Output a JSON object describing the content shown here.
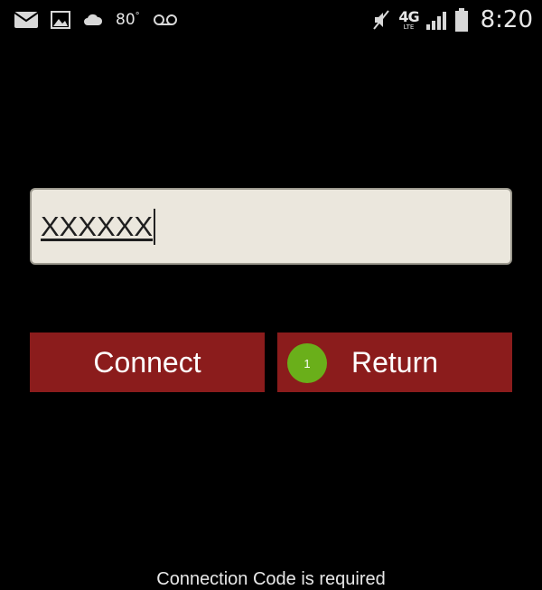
{
  "status_bar": {
    "left_icons": [
      "mail-icon",
      "image-icon",
      "cloud-icon",
      "voicemail-icon"
    ],
    "temperature": "80",
    "temperature_unit": "°",
    "network": "4G",
    "network_sub": "LTE",
    "right_icons": [
      "mute-icon",
      "signal-icon",
      "battery-icon"
    ],
    "time": "8:20"
  },
  "form": {
    "code_value": "XXXXXX"
  },
  "buttons": {
    "connect_label": "Connect",
    "return_label": "Return",
    "return_badge": "1"
  },
  "footer": {
    "message": "Connection Code is required"
  },
  "colors": {
    "background": "#000000",
    "button": "#8b1c1c",
    "input_bg": "#ebe7dd",
    "badge": "#6aaf1a"
  }
}
